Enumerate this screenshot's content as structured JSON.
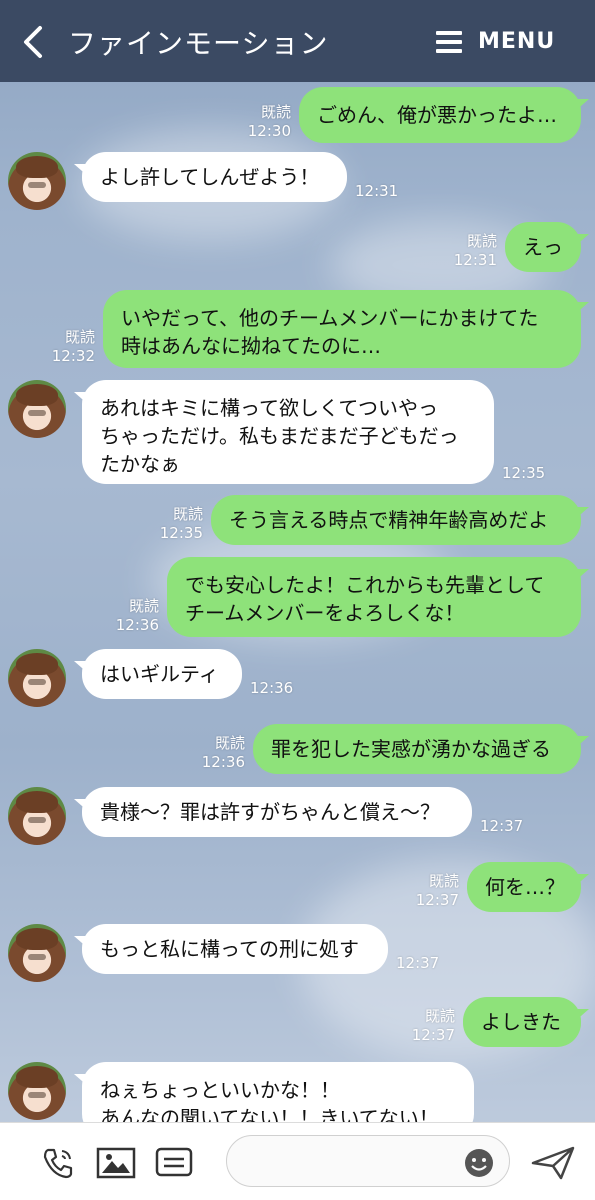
{
  "header": {
    "title": "ファインモーション",
    "menu_label": "MENU"
  },
  "read_label": "既読",
  "messages": [
    {
      "side": "out",
      "lines": [
        "ごめん、俺が悪かったよ…"
      ],
      "time": "12:30"
    },
    {
      "side": "in",
      "lines": [
        "よし許してしんぜよう！"
      ],
      "time": "12:31"
    },
    {
      "side": "out",
      "lines": [
        "えっ"
      ],
      "time": "12:31"
    },
    {
      "side": "out",
      "lines": [
        "いやだって、他のチームメンバーにかまけてた",
        "時はあんなに拗ねてたのに…"
      ],
      "time": "12:32"
    },
    {
      "side": "in",
      "lines": [
        "あれはキミに構って欲しくてついやっ",
        "ちゃっただけ。私もまだまだ子どもだっ",
        "たかなぁ"
      ],
      "time": "12:35"
    },
    {
      "side": "out",
      "lines": [
        "そう言える時点で精神年齢高めだよ"
      ],
      "time": "12:35"
    },
    {
      "side": "out",
      "lines": [
        "でも安心したよ！これからも先輩として",
        "チームメンバーをよろしくな！"
      ],
      "time": "12:36"
    },
    {
      "side": "in",
      "lines": [
        "はいギルティ"
      ],
      "time": "12:36"
    },
    {
      "side": "out",
      "lines": [
        "罪を犯した実感が湧かな過ぎる"
      ],
      "time": "12:36"
    },
    {
      "side": "in",
      "lines": [
        "貴様～？罪は許すがちゃんと償え～？"
      ],
      "time": "12:37"
    },
    {
      "side": "out",
      "lines": [
        "何を…？"
      ],
      "time": "12:37"
    },
    {
      "side": "in",
      "lines": [
        "もっと私に構っての刑に処す"
      ],
      "time": "12:37"
    },
    {
      "side": "out",
      "lines": [
        "よしきた"
      ],
      "time": "12:37"
    },
    {
      "side": "in",
      "lines": [
        "ねぇちょっといいかな！！",
        "あんなの聞いてない！！きいてない！"
      ],
      "time": ""
    }
  ],
  "footer": {
    "icons": [
      "phone-icon",
      "image-icon",
      "keyboard-icon",
      "emoji-icon",
      "send-icon"
    ],
    "input_placeholder": ""
  },
  "colors": {
    "header_bg": "#3b4a63",
    "outgoing_bubble": "#8ee27a",
    "incoming_bubble": "#ffffff"
  }
}
